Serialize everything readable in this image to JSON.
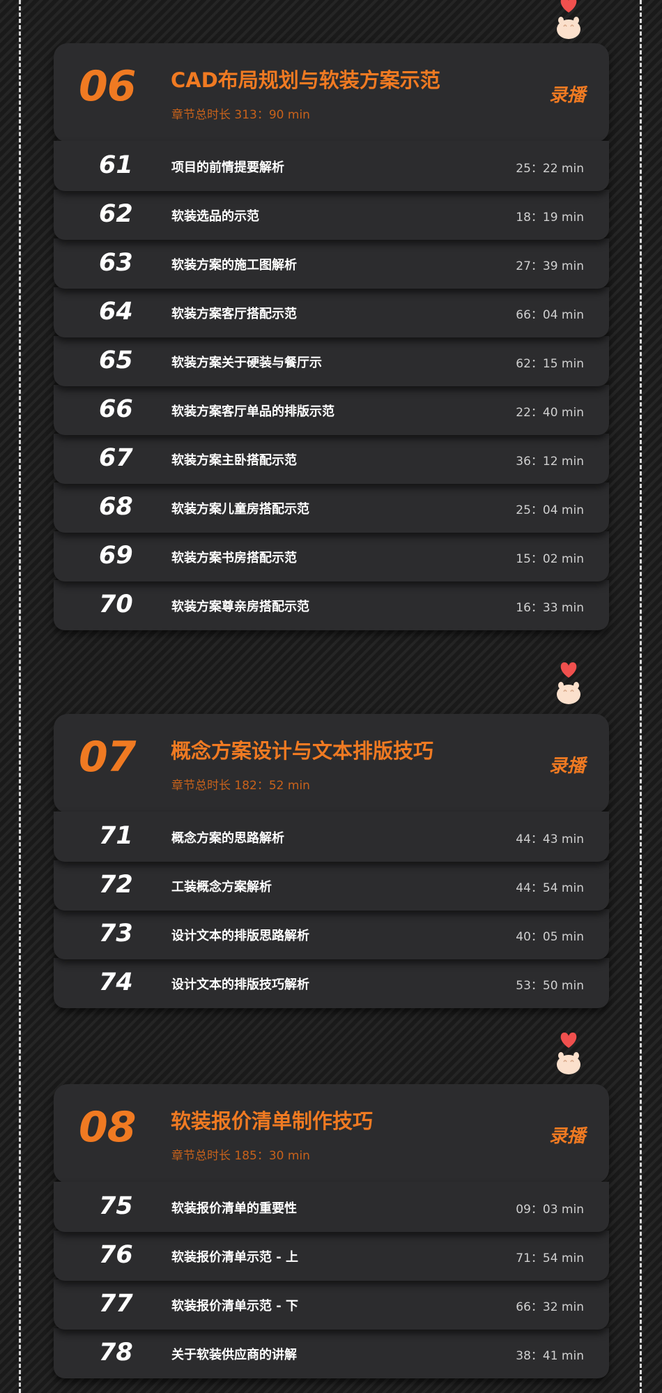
{
  "colors": {
    "accent": "#f07a22",
    "card": "#2c2c2e",
    "background": "#1c1c1c",
    "heart": "#f0504e",
    "paw": "#fbe0cc"
  },
  "chapters": [
    {
      "number": "06",
      "title": "CAD布局规划与软装方案示范",
      "duration": "章节总时长 313：90 min",
      "badge": "录播",
      "lessons": [
        {
          "num": "61",
          "title": "项目的前情提要解析",
          "time": "25：22 min"
        },
        {
          "num": "62",
          "title": "软装选品的示范",
          "time": "18：19 min"
        },
        {
          "num": "63",
          "title": "软装方案的施工图解析",
          "time": "27：39 min"
        },
        {
          "num": "64",
          "title": "软装方案客厅搭配示范",
          "time": "66：04 min"
        },
        {
          "num": "65",
          "title": "软装方案关于硬装与餐厅示",
          "time": "62：15 min"
        },
        {
          "num": "66",
          "title": "软装方案客厅单品的排版示范",
          "time": "22：40 min"
        },
        {
          "num": "67",
          "title": "软装方案主卧搭配示范",
          "time": "36：12 min"
        },
        {
          "num": "68",
          "title": "软装方案儿童房搭配示范",
          "time": "25：04 min"
        },
        {
          "num": "69",
          "title": "软装方案书房搭配示范",
          "time": "15：02 min"
        },
        {
          "num": "70",
          "title": "软装方案尊亲房搭配示范",
          "time": "16：33 min"
        }
      ]
    },
    {
      "number": "07",
      "title": "概念方案设计与文本排版技巧",
      "duration": "章节总时长 182：52 min",
      "badge": "录播",
      "lessons": [
        {
          "num": "71",
          "title": "概念方案的思路解析",
          "time": "44：43 min"
        },
        {
          "num": "72",
          "title": "工装概念方案解析",
          "time": "44：54 min"
        },
        {
          "num": "73",
          "title": "设计文本的排版思路解析",
          "time": "40：05 min"
        },
        {
          "num": "74",
          "title": "设计文本的排版技巧解析",
          "time": "53：50 min"
        }
      ]
    },
    {
      "number": "08",
      "title": "软装报价清单制作技巧",
      "duration": "章节总时长 185：30 min",
      "badge": "录播",
      "lessons": [
        {
          "num": "75",
          "title": "软装报价清单的重要性",
          "time": "09：03 min"
        },
        {
          "num": "76",
          "title": "软装报价清单示范 - 上",
          "time": "71：54 min"
        },
        {
          "num": "77",
          "title": "软装报价清单示范 - 下",
          "time": "66：32 min"
        },
        {
          "num": "78",
          "title": "关于软装供应商的讲解",
          "time": "38：41 min"
        }
      ]
    }
  ],
  "icons": {
    "mascot": "heart-paw-icon"
  }
}
